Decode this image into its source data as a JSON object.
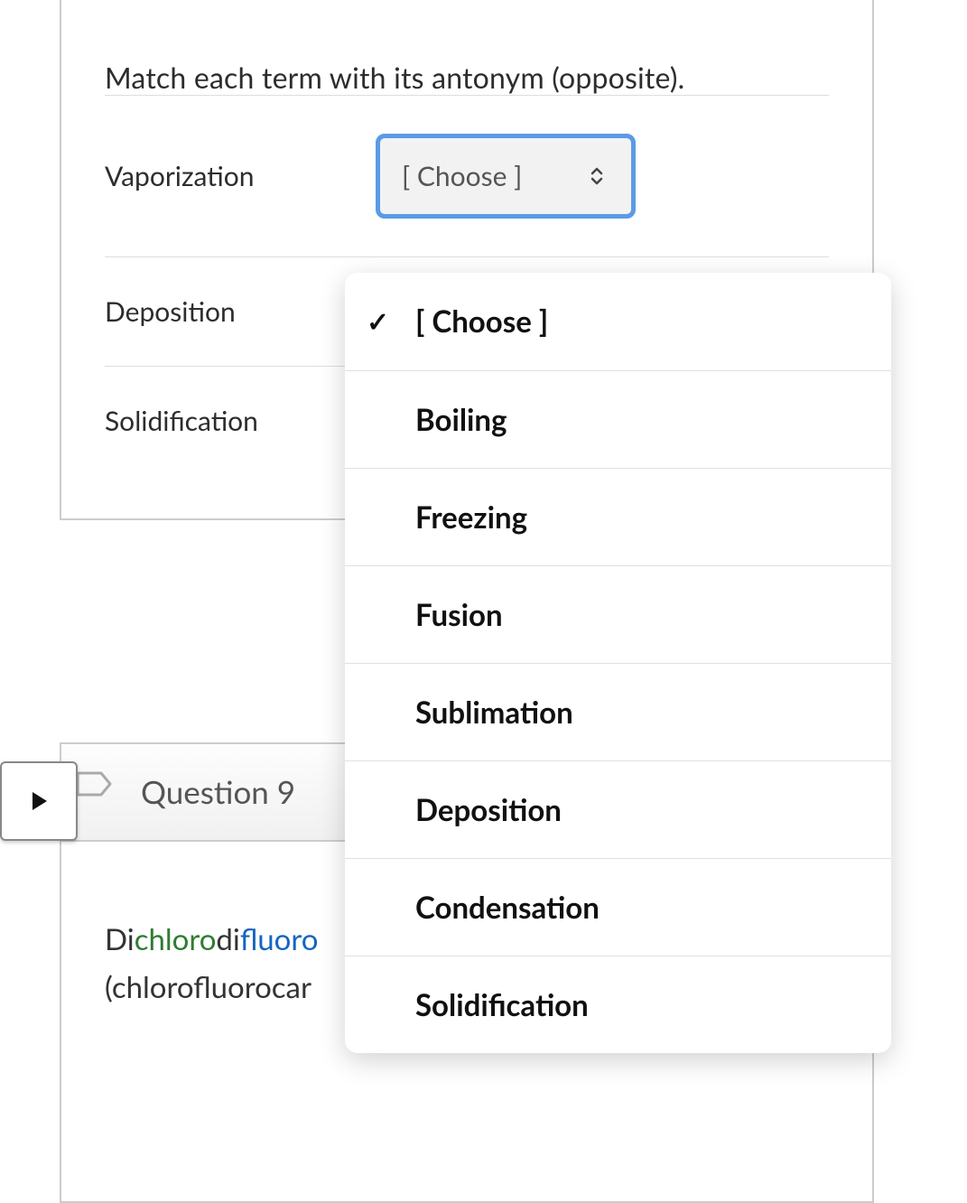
{
  "question8": {
    "prompt": "Match each term with its antonym (opposite).",
    "rows": [
      {
        "term": "Vaporization",
        "placeholder": "[ Choose ]"
      },
      {
        "term": "Deposition",
        "placeholder": "[ Choose ]"
      },
      {
        "term": "Solidification",
        "placeholder": "[ Choose ]"
      }
    ]
  },
  "dropdown": {
    "options": [
      {
        "label": "[ Choose ]",
        "selected": true
      },
      {
        "label": "Boiling",
        "selected": false
      },
      {
        "label": "Freezing",
        "selected": false
      },
      {
        "label": "Fusion",
        "selected": false
      },
      {
        "label": "Sublimation",
        "selected": false
      },
      {
        "label": "Deposition",
        "selected": false
      },
      {
        "label": "Condensation",
        "selected": false
      },
      {
        "label": "Solidification",
        "selected": false
      }
    ]
  },
  "question9": {
    "header": "Question 9",
    "line1_prefix": "Di",
    "line1_chloro": "chloro",
    "line1_mid": "di",
    "line1_fluoro": "fluoro",
    "line2_partial": "(chlorofluorocar"
  }
}
